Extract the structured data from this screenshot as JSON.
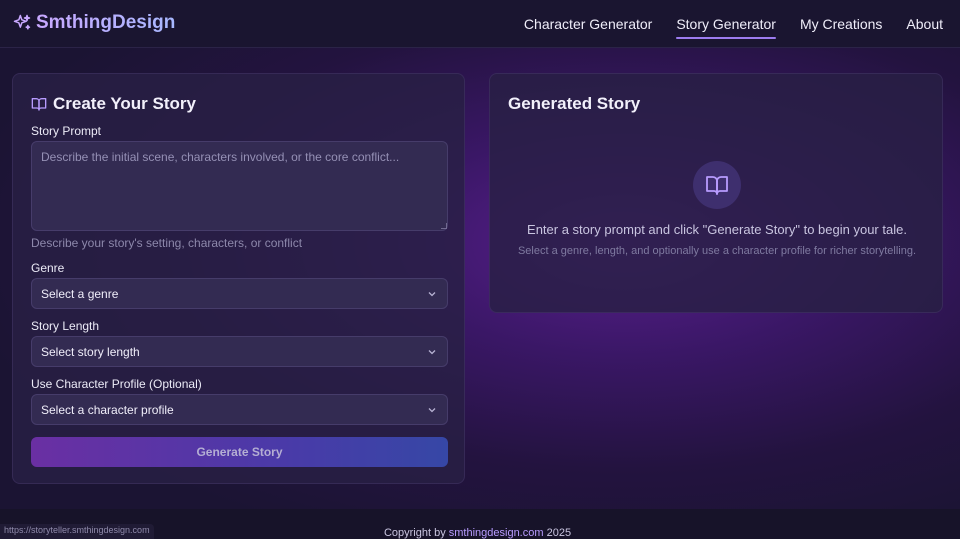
{
  "header": {
    "brand": "SmthingDesign",
    "brand_icon": "sparkles-icon",
    "nav": [
      {
        "label": "Character Generator",
        "active": false
      },
      {
        "label": "Story Generator",
        "active": true
      },
      {
        "label": "My Creations",
        "active": false
      },
      {
        "label": "About",
        "active": false
      }
    ]
  },
  "form": {
    "title": "Create Your Story",
    "title_icon": "open-book-icon",
    "prompt_label": "Story Prompt",
    "prompt_placeholder": "Describe the initial scene, characters involved, or the core conflict...",
    "prompt_value": "",
    "prompt_hint": "Describe your story's setting, characters, or conflict",
    "genre_label": "Genre",
    "genre_value": "Select a genre",
    "length_label": "Story Length",
    "length_value": "Select story length",
    "profile_label": "Use Character Profile (Optional)",
    "profile_value": "Select a character profile",
    "submit_label": "Generate Story"
  },
  "output": {
    "title": "Generated Story",
    "empty_icon": "open-book-icon",
    "empty_message": "Enter a story prompt and click \"Generate Story\" to begin your tale.",
    "empty_sub": "Select a genre, length, and optionally use a character profile for richer storytelling."
  },
  "footer": {
    "prefix": "Copyright by ",
    "link": "smthingdesign.com",
    "suffix": " 2025"
  },
  "status_bar_url": "https://storyteller.smthingdesign.com",
  "colors": {
    "accent": "#9d7cf0",
    "button_start": "#6a2fa3",
    "button_end": "#3647a6",
    "card_bg": "#282044"
  }
}
